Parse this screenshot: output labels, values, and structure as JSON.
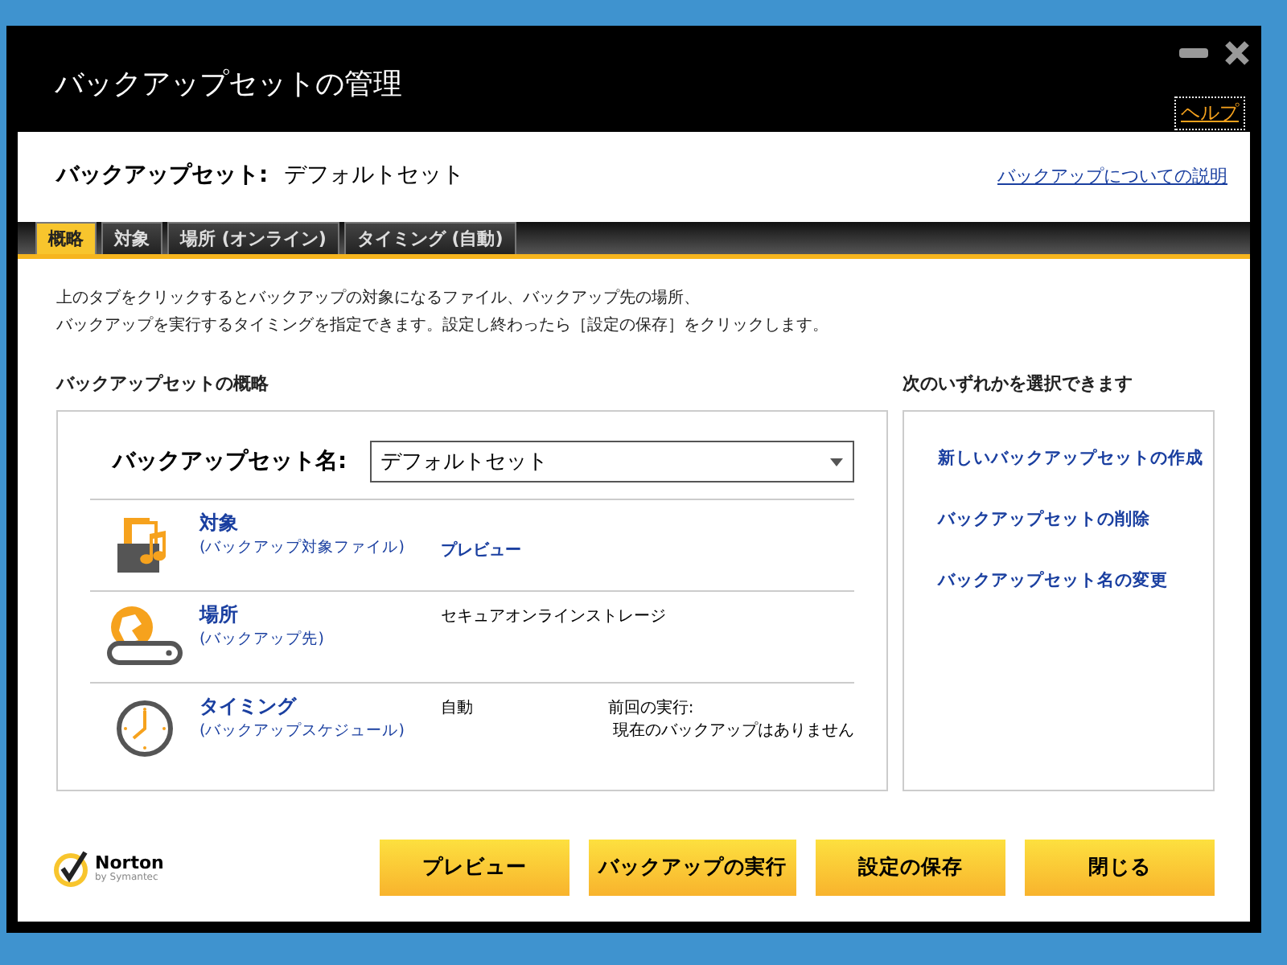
{
  "window": {
    "title": "バックアップセットの管理",
    "help_link": "ヘルプ"
  },
  "header": {
    "label": "バックアップセット:",
    "value": "デフォルトセット",
    "link": "バックアップについての説明"
  },
  "tabs": [
    {
      "label": "概略",
      "selected": true
    },
    {
      "label": "対象",
      "selected": false
    },
    {
      "label": "場所 (オンライン)",
      "selected": false
    },
    {
      "label": "タイミング (自動)",
      "selected": false
    }
  ],
  "description": [
    "上のタブをクリックするとバックアップの対象になるファイル、バックアップ先の場所、",
    "バックアップを実行するタイミングを指定できます。設定し終わったら［設定の保存］をクリックします。"
  ],
  "overview": {
    "heading": "バックアップセットの概略",
    "name_label": "バックアップセット名:",
    "name_value": "デフォルトセット",
    "rows": [
      {
        "kind": "files",
        "title": "対象",
        "subtitle": "(バックアップ対象ファイル)",
        "value": "プレビュー",
        "value_is_link": true
      },
      {
        "kind": "location",
        "title": "場所",
        "subtitle": "(バックアップ先)",
        "value": "セキュアオンラインストレージ",
        "value_is_link": false
      },
      {
        "kind": "timing",
        "title": "タイミング",
        "subtitle": "(バックアップスケジュール)",
        "value": "自動",
        "value_is_link": false,
        "note_label": "前回の実行:",
        "note_value": "現在のバックアップはありません"
      }
    ]
  },
  "actions": {
    "heading": "次のいずれかを選択できます",
    "links": [
      "新しいバックアップセットの作成",
      "バックアップセットの削除",
      "バックアップセット名の変更"
    ]
  },
  "logo": {
    "name": "Norton",
    "tagline": "by Symantec"
  },
  "buttons": [
    "プレビュー",
    "バックアップの実行",
    "設定の保存",
    "閉じる"
  ]
}
